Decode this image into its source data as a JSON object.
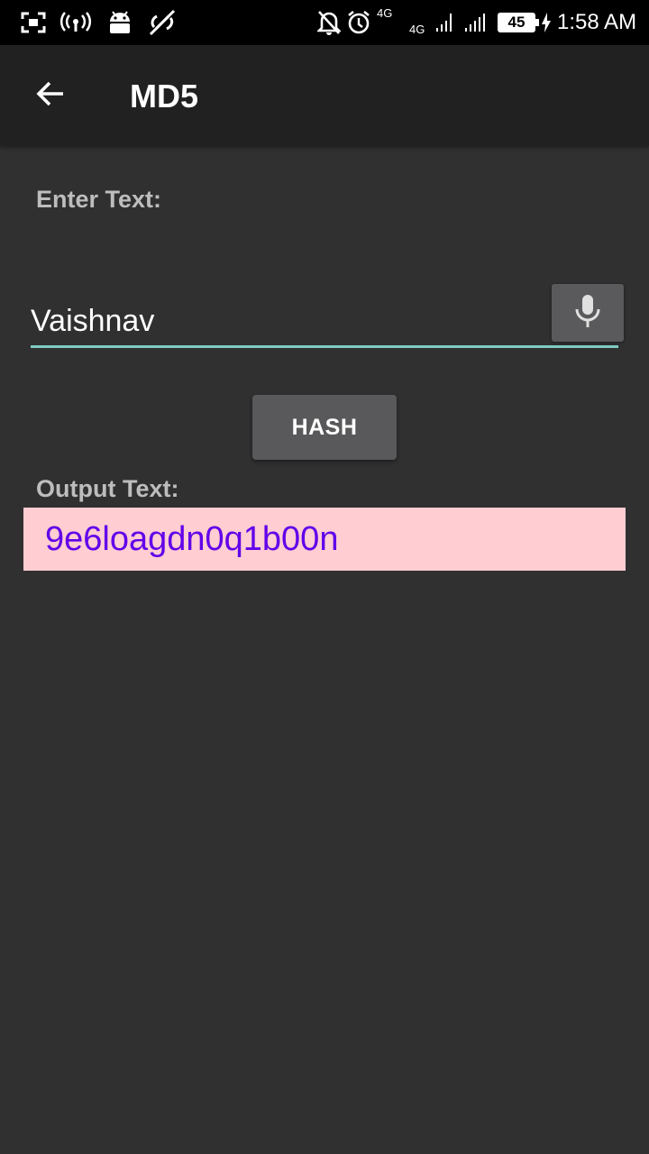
{
  "status_bar": {
    "network_top": "4G",
    "network_bottom": "4G",
    "battery": "45",
    "time": "1:58 AM"
  },
  "app_bar": {
    "title": "MD5"
  },
  "form": {
    "enter_label": "Enter Text:",
    "input_value": "Vaishnav",
    "hash_button": "HASH",
    "output_label": "Output Text:",
    "output_value": "9e6loagdn0q1b00n"
  },
  "colors": {
    "background": "#303030",
    "app_bar": "#212121",
    "accent": "#80cbc4",
    "output_bg": "#ffcdd2",
    "output_text": "#6200ea"
  }
}
